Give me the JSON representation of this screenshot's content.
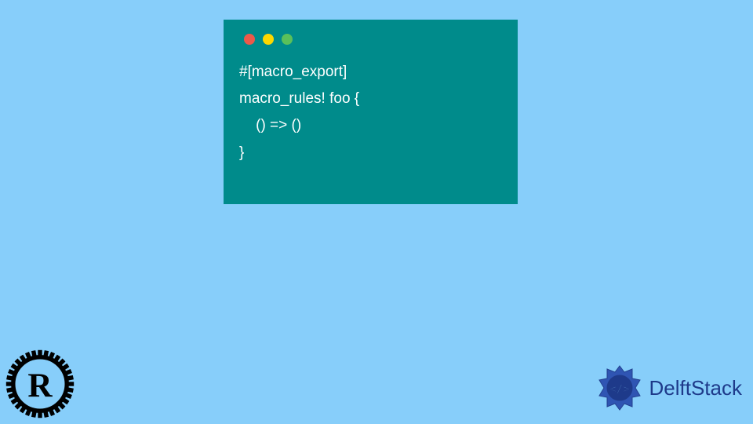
{
  "code": {
    "line1": "#[macro_export]",
    "line2": "macro_rules! foo {",
    "line3": "    () => ()",
    "line4": "}"
  },
  "brand": {
    "name": "DelftStack"
  },
  "colors": {
    "background": "#87cefa",
    "window": "#008b8b",
    "dot_red": "#ed594a",
    "dot_yellow": "#fdd800",
    "dot_green": "#5ac05a",
    "brand_blue": "#1e3a8a"
  }
}
